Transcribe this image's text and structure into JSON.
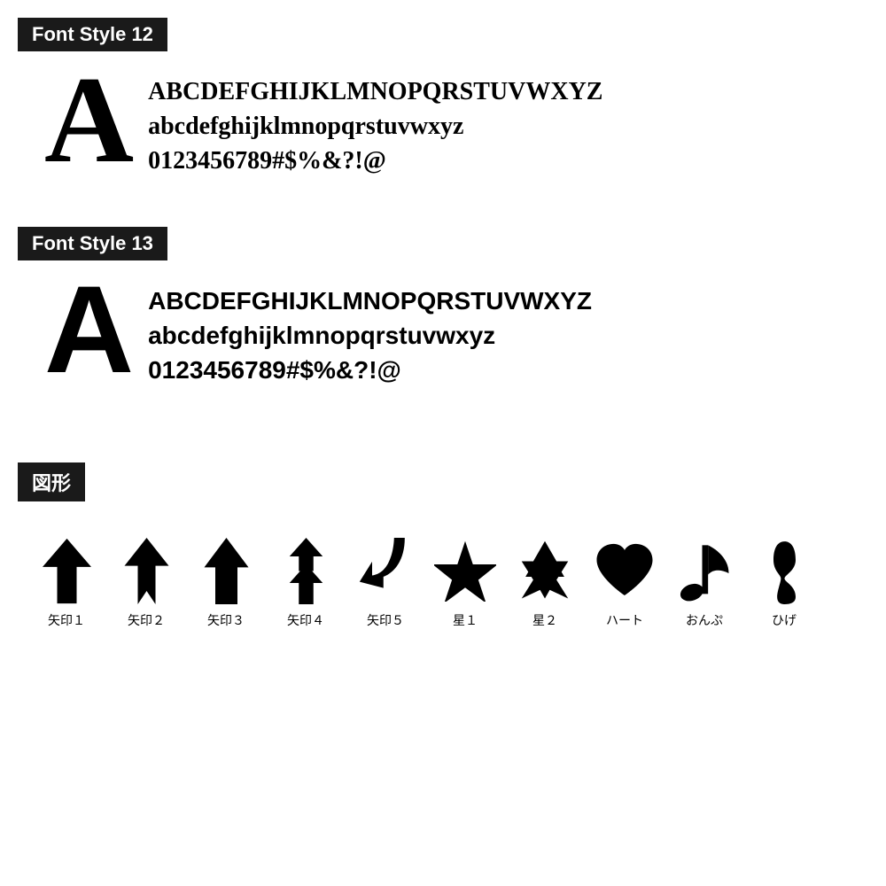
{
  "sections": [
    {
      "id": "font-style-12",
      "label": "Font Style 12",
      "style": "serif",
      "bigLetter": "A",
      "lines": [
        "ABCDEFGHIJKLMNOPQRSTUVWXYZ",
        "abcdefghijklmnopqrstuvwxyz",
        "0123456789#$%&?!@"
      ]
    },
    {
      "id": "font-style-13",
      "label": "Font Style 13",
      "style": "sans-serif",
      "bigLetter": "A",
      "lines": [
        "ABCDEFGHIJKLMNOPQRSTUVWXYZ",
        "abcdefghijklmnopqrstuvwxyz",
        "0123456789#$%&?!@"
      ]
    }
  ],
  "shapes_section": {
    "label": "図形",
    "items": [
      {
        "id": "yajirushi1",
        "label": "矢印１"
      },
      {
        "id": "yajirushi2",
        "label": "矢印２"
      },
      {
        "id": "yajirushi3",
        "label": "矢印３"
      },
      {
        "id": "yajirushi4",
        "label": "矢印４"
      },
      {
        "id": "yajirushi5",
        "label": "矢印５"
      },
      {
        "id": "hoshi1",
        "label": "星１"
      },
      {
        "id": "hoshi2",
        "label": "星２"
      },
      {
        "id": "heart",
        "label": "ハート"
      },
      {
        "id": "onpu",
        "label": "おんぷ"
      },
      {
        "id": "hige",
        "label": "ひげ"
      }
    ]
  }
}
